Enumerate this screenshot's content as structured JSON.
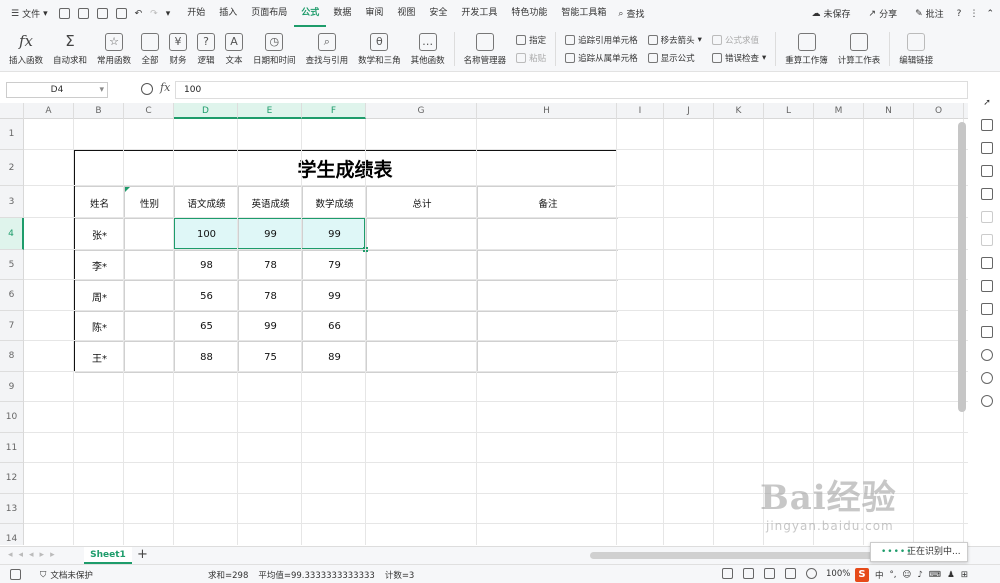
{
  "menubar": {
    "file_label": "文件",
    "tabs": [
      {
        "label": "开始"
      },
      {
        "label": "插入"
      },
      {
        "label": "页面布局"
      },
      {
        "label": "公式",
        "active": true
      },
      {
        "label": "数据"
      },
      {
        "label": "审阅"
      },
      {
        "label": "视图"
      },
      {
        "label": "安全"
      },
      {
        "label": "开发工具"
      },
      {
        "label": "特色功能"
      },
      {
        "label": "智能工具箱"
      }
    ],
    "search_label": "查找",
    "unsaved_label": "未保存",
    "share_label": "分享",
    "comment_label": "批注",
    "help_label": "?"
  },
  "ribbon": {
    "insert_function": "插入函数",
    "autosum": "自动求和",
    "common_functions": "常用函数",
    "all": "全部",
    "finance": "财务",
    "logic": "逻辑",
    "text": "文本",
    "datetime": "日期和时间",
    "lookup": "查找与引用",
    "math": "数学和三角",
    "other_functions": "其他函数",
    "name_manager": "名称管理器",
    "specify": "指定",
    "paste": "粘贴",
    "trace_precedents": "追踪引用单元格",
    "trace_dependents": "追踪从属单元格",
    "remove_arrows": "移去箭头",
    "show_formulas": "显示公式",
    "evaluate_formula": "公式求值",
    "error_check": "错误检查",
    "recalc_workbook": "重算工作簿",
    "calc_sheet": "计算工作表",
    "edit_links": "编辑链接"
  },
  "formula_bar": {
    "cell_ref": "D4",
    "fx_label": "fx",
    "value": "100"
  },
  "columns": [
    "A",
    "B",
    "C",
    "D",
    "E",
    "F",
    "G",
    "H",
    "I",
    "J",
    "K",
    "L",
    "M",
    "N",
    "O"
  ],
  "rows": [
    "1",
    "2",
    "3",
    "4",
    "5",
    "6",
    "7",
    "8",
    "9",
    "10",
    "11",
    "12",
    "13",
    "14"
  ],
  "sheet": {
    "title": "学生成绩表",
    "headers": [
      "姓名",
      "性别",
      "语文成绩",
      "英语成绩",
      "数学成绩",
      "总计",
      "备注"
    ],
    "data": [
      [
        "张*",
        "",
        "100",
        "99",
        "99",
        "",
        ""
      ],
      [
        "李*",
        "",
        "98",
        "78",
        "79",
        "",
        ""
      ],
      [
        "周*",
        "",
        "56",
        "78",
        "99",
        "",
        ""
      ],
      [
        "陈*",
        "",
        "65",
        "99",
        "66",
        "",
        ""
      ],
      [
        "王*",
        "",
        "88",
        "75",
        "89",
        "",
        ""
      ]
    ]
  },
  "sheetbar": {
    "active_sheet": "Sheet1",
    "add_label": "+"
  },
  "statusbar": {
    "protect_label": "文档未保护",
    "sum": "求和=298",
    "average": "平均值=99.3333333333333",
    "count": "计数=3",
    "zoom": "100%"
  },
  "toast": "正在识别中...",
  "watermark": {
    "line1": "Bai经验",
    "line2": "jingyan.baidu.com"
  },
  "colors": {
    "accent": "#1e9c6b",
    "selection_fill": "#dff7f7",
    "ime_red": "#e64a19"
  }
}
